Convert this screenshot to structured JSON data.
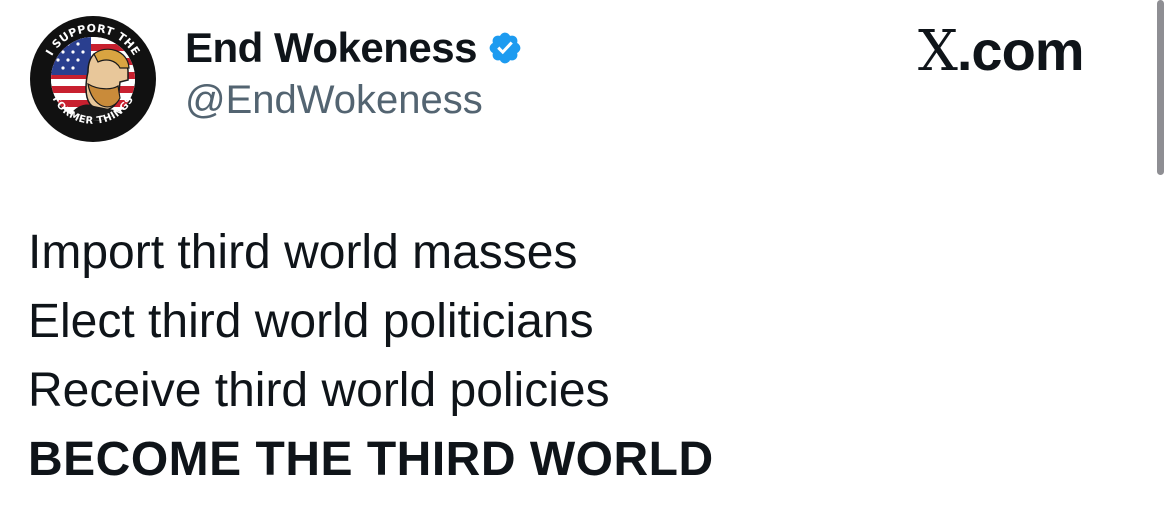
{
  "author": {
    "display_name": "End Wokeness",
    "handle": "@EndWokeness",
    "verified": true,
    "verified_color": "#1d9bf0",
    "avatar": {
      "ring_text_top": "I SUPPORT THE",
      "ring_text_bottom": "FORMER THINGS",
      "icon": "bearded-man-american-flag-icon"
    }
  },
  "brand": {
    "mark": "X",
    "suffix": ".com"
  },
  "tweet": {
    "lines": [
      "Import third world masses",
      "Elect third world politicians",
      "Receive third world policies"
    ],
    "emphasis_line": "BECOME THE THIRD WORLD"
  },
  "colors": {
    "text": "#0f1419",
    "secondary_text": "#536471",
    "background": "#ffffff"
  }
}
